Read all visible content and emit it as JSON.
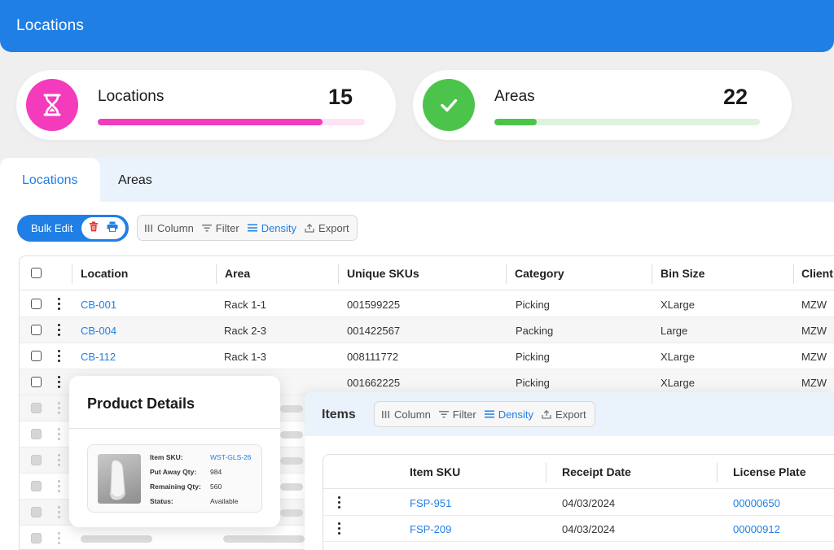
{
  "header": {
    "title": "Locations"
  },
  "stats": [
    {
      "label": "Locations",
      "count": "15",
      "icon": "hourglass-icon",
      "accent": "#f33bbc",
      "track": "#fde3f3",
      "progress": 0.84
    },
    {
      "label": "Areas",
      "count": "22",
      "icon": "checkmark-icon",
      "accent": "#4cc44c",
      "track": "#ddf3dd",
      "progress": 0.16
    }
  ],
  "tabs": [
    {
      "label": "Locations",
      "active": true
    },
    {
      "label": "Areas",
      "active": false
    }
  ],
  "bulk": {
    "label": "Bulk Edit",
    "delete_icon": "trash-icon",
    "print_icon": "printer-icon"
  },
  "toolbar": {
    "column": "Column",
    "filter": "Filter",
    "density": "Density",
    "export": "Export"
  },
  "locations_table": {
    "columns": [
      "Location",
      "Area",
      "Unique SKUs",
      "Category",
      "Bin Size",
      "Client"
    ],
    "rows": [
      {
        "location": "CB-001",
        "area": "Rack 1-1",
        "skus": "001599225",
        "category": "Picking",
        "bin": "XLarge",
        "client": "MZW"
      },
      {
        "location": "CB-004",
        "area": "Rack 2-3",
        "skus": "001422567",
        "category": "Packing",
        "bin": "Large",
        "client": "MZW"
      },
      {
        "location": "CB-112",
        "area": "Rack 1-3",
        "skus": "008111772",
        "category": "Picking",
        "bin": "XLarge",
        "client": "MZW"
      },
      {
        "location": "",
        "area": "",
        "skus": "001662225",
        "category": "Picking",
        "bin": "XLarge",
        "client": "MZW"
      }
    ]
  },
  "product_details": {
    "title": "Product Details",
    "item_sku_label": "Item SKU:",
    "item_sku": "WST-GLS-26",
    "put_away_label": "Put Away Qty:",
    "put_away": "984",
    "remaining_label": "Remaining Qty:",
    "remaining": "560",
    "status_label": "Status:",
    "status": "Available"
  },
  "items": {
    "title": "Items",
    "toolbar": {
      "column": "Column",
      "filter": "Filter",
      "density": "Density",
      "export": "Export"
    },
    "columns": [
      "Item SKU",
      "Receipt Date",
      "License Plate"
    ],
    "rows": [
      {
        "sku": "FSP-951",
        "date": "04/03/2024",
        "plate": "00000650"
      },
      {
        "sku": "FSP-209",
        "date": "04/03/2024",
        "plate": "00000912"
      }
    ]
  }
}
